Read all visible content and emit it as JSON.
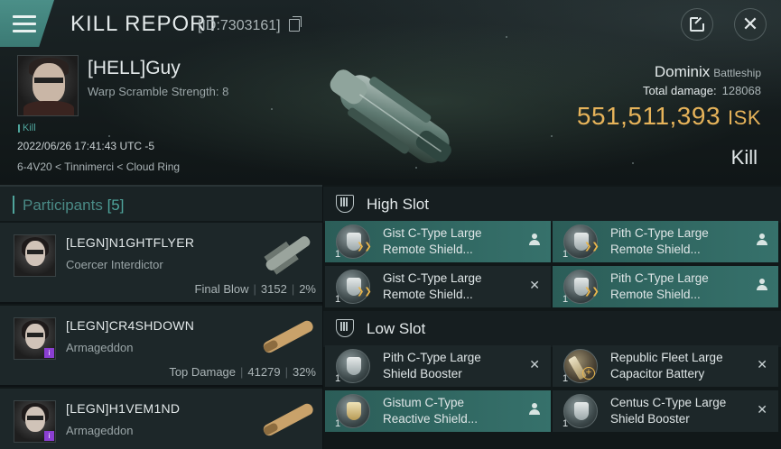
{
  "header": {
    "title": "KILL REPORT",
    "report_id": "[ID:7303161]"
  },
  "victim": {
    "name": "[HELL]Guy",
    "subtitle": "Warp Scramble Strength: 8",
    "tag": "Kill",
    "datetime": "2022/06/26 17:41:43 UTC -5",
    "location": "6-4V20 < Tinnimerci < Cloud Ring",
    "ship": "Dominix",
    "ship_class": "Battleship",
    "total_damage_label": "Total damage:",
    "total_damage": "128068",
    "isk_value": "551,511,393",
    "isk_unit": "ISK",
    "result": "Kill"
  },
  "participants": {
    "label": "Participants",
    "count": "[5]",
    "rows": [
      {
        "name": "[LEGN]N1GHTFLYER",
        "ship": "Coercer Interdictor",
        "stat_label": "Final Blow",
        "damage": "3152",
        "percent": "2%"
      },
      {
        "name": "[LEGN]CR4SHDOWN",
        "ship": "Armageddon",
        "stat_label": "Top Damage",
        "damage": "41279",
        "percent": "32%"
      },
      {
        "name": "[LEGN]H1VEM1ND",
        "ship": "Armageddon",
        "stat_label": "",
        "damage": "",
        "percent": ""
      }
    ]
  },
  "fitting": {
    "high_slot_label": "High Slot",
    "low_slot_label": "Low Slot",
    "high": [
      {
        "qty": "1",
        "line1": "Gist C-Type Large",
        "line2": "Remote Shield...",
        "state": "dropped"
      },
      {
        "qty": "1",
        "line1": "Pith C-Type Large",
        "line2": "Remote Shield...",
        "state": "dropped"
      },
      {
        "qty": "1",
        "line1": "Gist C-Type Large",
        "line2": "Remote Shield...",
        "state": "destroyed"
      },
      {
        "qty": "1",
        "line1": "Pith C-Type Large",
        "line2": "Remote Shield...",
        "state": "dropped"
      }
    ],
    "low": [
      {
        "qty": "1",
        "line1": "Pith C-Type Large",
        "line2": "Shield Booster",
        "state": "destroyed"
      },
      {
        "qty": "1",
        "line1": "Republic Fleet Large",
        "line2": "Capacitor Battery",
        "state": "destroyed"
      },
      {
        "qty": "1",
        "line1": "Gistum C-Type",
        "line2": "Reactive Shield...",
        "state": "dropped"
      },
      {
        "qty": "1",
        "line1": "Centus C-Type Large",
        "line2": "Shield Booster",
        "state": "destroyed"
      }
    ],
    "destroyed_glyph": "✕"
  },
  "colors": {
    "accent": "#4fa59c",
    "isk": "#e6b35a",
    "dropped_row": "#36716b",
    "badge": "#8a3fd1"
  },
  "icons": [
    "menu-icon",
    "copy-icon",
    "share-icon",
    "close-icon",
    "high-slot-icon",
    "low-slot-icon",
    "shield-booster-icon",
    "capacitor-battery-icon",
    "pilot-icon",
    "destroyed-icon"
  ]
}
